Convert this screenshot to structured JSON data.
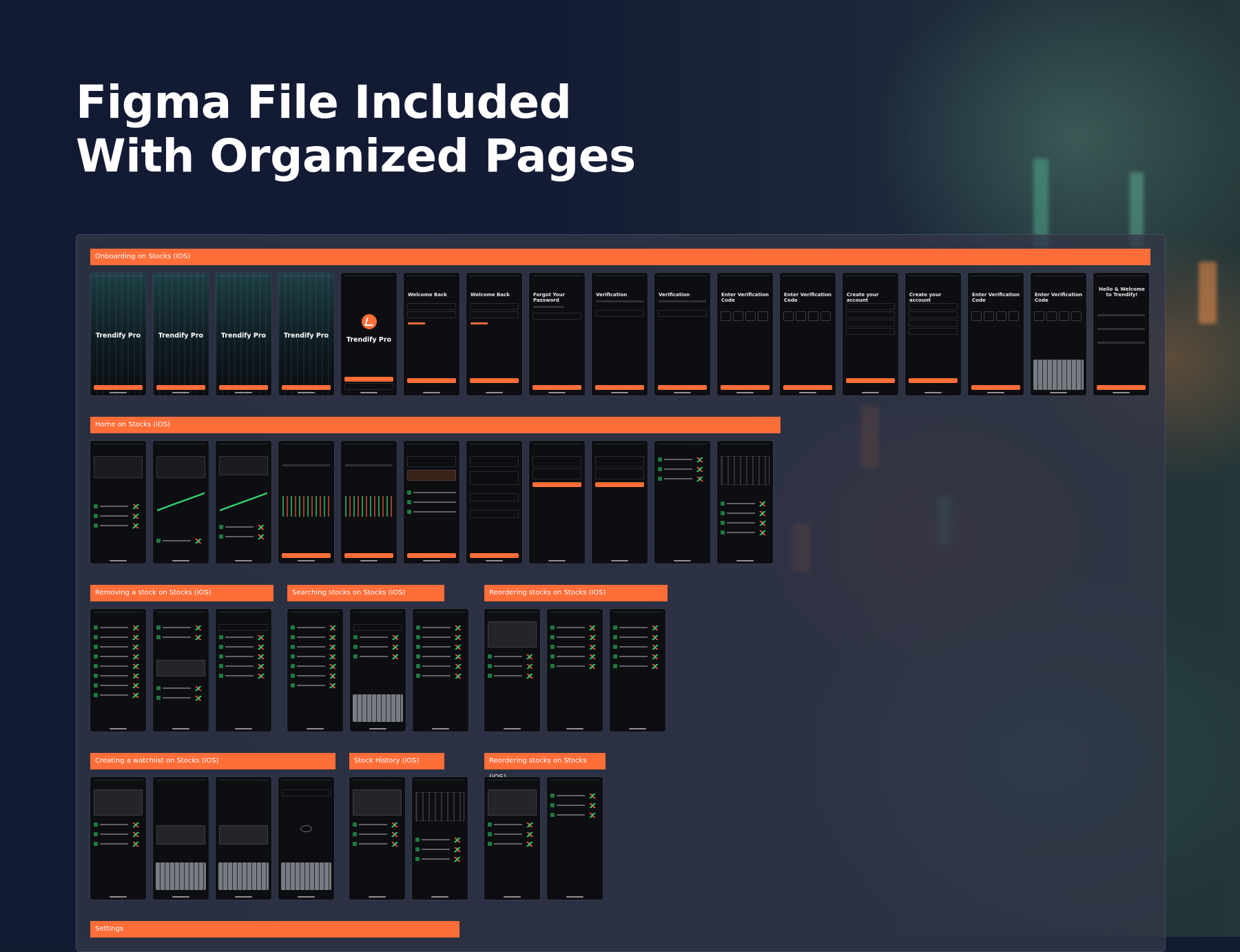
{
  "hero": {
    "line1": "Figma File Included",
    "line2": "With Organized Pages"
  },
  "colors": {
    "accent": "#ff6d38",
    "background": "#131b33",
    "screen": "#0d0e12"
  },
  "sections": [
    {
      "label": "Onboarding on Stocks (iOS)",
      "screen_count": 17
    },
    {
      "label": "Home on Stocks (iOS)",
      "screen_count": 11
    },
    {
      "label": "Removing a stock on Stocks (iOS)",
      "screen_count": 3
    },
    {
      "label": "Searching stocks on Stocks (iOS)",
      "screen_count": 3
    },
    {
      "label": "Reordering stocks on Stocks (iOS)",
      "screen_count": 3
    },
    {
      "label": "Creating a watchlist on Stocks (iOS)",
      "screen_count": 4
    },
    {
      "label": "Stock History (iOS)",
      "screen_count": 2
    },
    {
      "label": "Reordering stocks on Stocks (iOS)",
      "screen_count": 2
    },
    {
      "label": "Settings",
      "screen_count": 0
    }
  ],
  "onboarding_titles": [
    "Trendify Pro",
    "Trendify Pro",
    "Trendify Pro",
    "Trendify Pro",
    "Trendify Pro",
    "Welcome Back",
    "Welcome Back",
    "Forgot Your Password",
    "Verification",
    "Verification",
    "Enter Verification Code",
    "Enter Verification Code",
    "Create your account",
    "Create your account",
    "Enter Verification Code",
    "Enter Verification Code",
    "Hello & Welcome to Trendify!"
  ]
}
